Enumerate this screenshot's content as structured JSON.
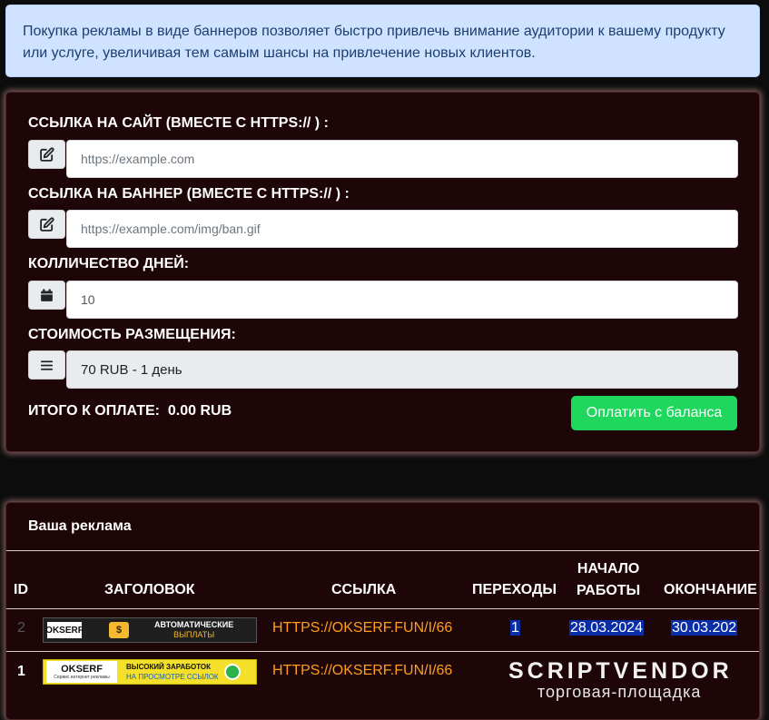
{
  "info": {
    "text": "Покупка рекламы в виде баннеров позволяет быстро привлечь внимание аудитории к вашему продукту или услуге, увеличивая тем самым шансы на привлечение новых клиентов."
  },
  "form": {
    "site_label": "ССЫЛКА НА САЙТ (ВМЕСТЕ С HTTPS:// ) :",
    "site_placeholder": "https://example.com",
    "banner_label": "ССЫЛКА НА БАННЕР (ВМЕСТЕ С HTTPS:// ) :",
    "banner_placeholder": "https://example.com/img/ban.gif",
    "days_label": "КОЛЛИЧЕСТВО ДНЕЙ:",
    "days_value": "10",
    "cost_label": "СТОИМОСТЬ РАЗМЕЩЕНИЯ:",
    "cost_value": "70 RUB - 1 день",
    "total_label": "ИТОГО К ОПЛАТЕ:",
    "total_value": "0.00 RUB",
    "pay_button": "Оплатить с баланса"
  },
  "ads": {
    "title": "Ваша реклама",
    "headers": {
      "id": "ID",
      "title": "ЗАГОЛОВОК",
      "link": "ССЫЛКА",
      "clicks": "ПЕРЕХОДЫ",
      "start_1": "НАЧАЛО",
      "start_2": "РАБОТЫ",
      "end": "ОКОНЧАНИЕ"
    },
    "rows": [
      {
        "id": "2",
        "banner_brand": "OKSERF",
        "banner_text_1": "АВТОМАТИЧЕСКИЕ",
        "banner_text_2": "ВЫПЛАТЫ",
        "link": "HTTPS://OKSERF.FUN/I/66",
        "clicks": "1",
        "start": "28.03.2024",
        "end": "30.03.202"
      },
      {
        "id": "1",
        "banner_brand": "OKSERF",
        "banner_sub": "Сервис интернет рекламы",
        "banner_text_1": "ВЫСОКИЙ ЗАРАБОТОК",
        "banner_text_2": "НА ПРОСМОТРЕ ССЫЛОК",
        "link": "HTTPS://OKSERF.FUN/I/66"
      }
    ]
  },
  "watermark": {
    "brand": "SCRIPTVENDOR",
    "sub": "торговая-площадка"
  }
}
